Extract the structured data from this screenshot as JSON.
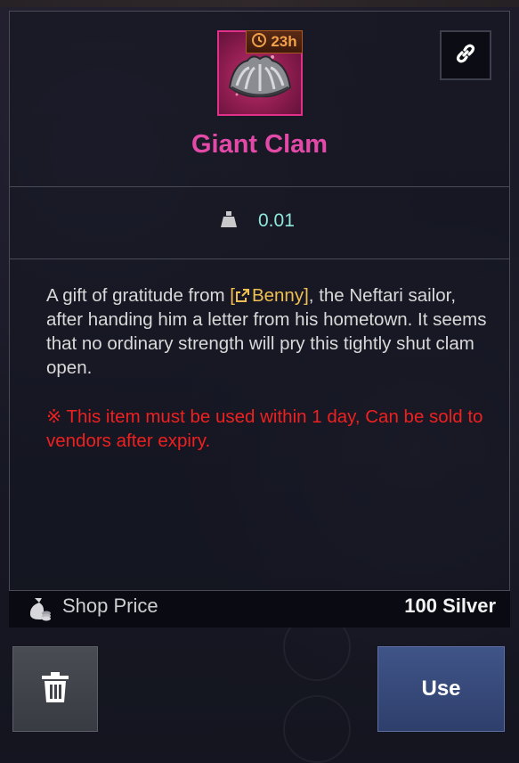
{
  "item": {
    "name": "Giant Clam",
    "timer": "23h",
    "weight": "0.01",
    "description": {
      "before_link": "A gift of gratitude from ",
      "link_prefix": "[",
      "link_text": "Benny",
      "link_suffix": "]",
      "after_link": ", the Neftari sailor, after handing him a letter from his hometown. It seems that no ordinary strength will pry this tightly shut clam open."
    },
    "warning": "※ This item must be used within 1 day, Can be sold to vendors after expiry."
  },
  "price": {
    "label": "Shop Price",
    "value": "100 Silver"
  },
  "actions": {
    "use_label": "Use"
  },
  "icons": {
    "item": "giant-clam-icon",
    "timer": "clock-icon",
    "link": "chain-link-icon",
    "weight": "weight-icon",
    "link_inline": "external-link-icon",
    "price": "money-bag-icon",
    "delete": "trash-icon"
  },
  "colors": {
    "title": "#e34aa8",
    "weight": "#8fe7dd",
    "link": "#f0bf52",
    "warning": "#ee2020",
    "icon_border": "#e0308a",
    "use_button": "#3f5488"
  }
}
